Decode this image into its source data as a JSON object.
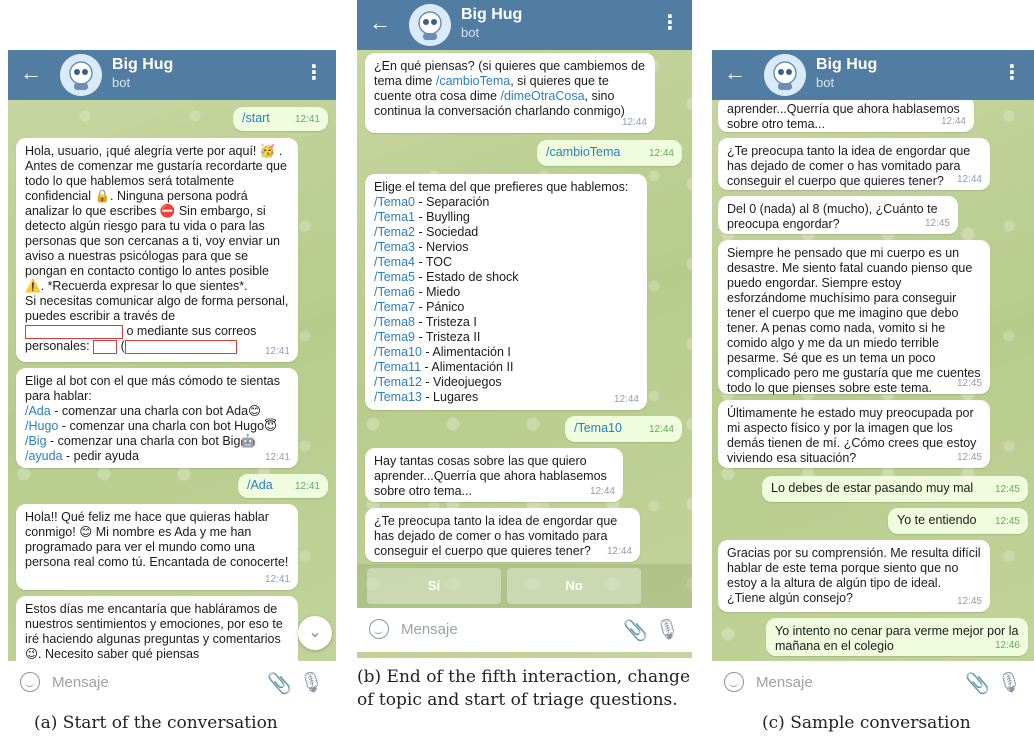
{
  "common": {
    "bot_name": "Big Hug",
    "bot_subtitle": "bot",
    "message_placeholder": "Mensaje"
  },
  "panel_a": {
    "caption": "(a) Start of the conversation",
    "messages": [
      {
        "dir": "out",
        "text": "/start",
        "time": "12:41"
      },
      {
        "dir": "in",
        "time": "12:41",
        "text": "Hola, usuario, ¡qué alegría verte por aquí! 🥳 . Antes de comenzar me gustaría recordarte que todo lo que hablemos será totalmente confidencial 🔒. Ninguna persona podrá analizar lo que escribes ⛔ Sin embargo, si detecto algún riesgo para tu vida o para las personas que son cercanas a ti, voy enviar un aviso a nuestras psicólogas para que se pongan en contacto contigo lo antes posible ⚠️. *Recuerda expresar lo que sientes*.",
        "text2": "Si necesitas comunicar algo de forma personal, puedes escribir a través de",
        "text3": "o mediante sus correos",
        "text4": "personales:"
      },
      {
        "dir": "in",
        "time": "12:41",
        "intro": "Elige al bot con el que más cómodo te sientas para hablar:",
        "lines": [
          {
            "cmd": "/Ada",
            "text": " - comenzar una charla con bot Ada😊"
          },
          {
            "cmd": "/Hugo",
            "text": " - comenzar una charla con bot Hugo😇"
          },
          {
            "cmd": "/Big",
            "text": " - comenzar una charla con bot Big🤖"
          },
          {
            "cmd": "/ayuda",
            "text": " - pedir ayuda"
          }
        ]
      },
      {
        "dir": "out",
        "text": "/Ada",
        "time": "12:41"
      },
      {
        "dir": "in",
        "time": "12:41",
        "text": "Hola!! Qué feliz me hace que quieras hablar conmigo! 😊 Mi nombre es Ada y me han programado para ver el mundo como una persona real como tú. Encantada de conocerte!"
      },
      {
        "dir": "in",
        "time": "",
        "text": "Estos días me encantaría que habláramos de nuestros sentimientos y emociones, por eso te iré haciendo algunas preguntas y comentarios 😉. Necesito saber qué piensas"
      }
    ]
  },
  "panel_b": {
    "caption": "(b) End of the fifth interaction, change of topic and start of triage questions.",
    "messages": [
      {
        "dir": "in",
        "time": "12:44",
        "pre": "¿En qué piensas? (si quieres que cambiemos de tema dime ",
        "cmd1": "/cambioTema",
        "mid": ", si quieres que te cuente otra cosa dime ",
        "cmd2": "/dimeOtraCosa",
        "post": ", sino continua la conversación charlando conmigo)"
      },
      {
        "dir": "out",
        "text": "/cambioTema",
        "time": "12:44"
      },
      {
        "dir": "in",
        "time": "12:44",
        "intro": "Elige el tema del que prefieres que hablemos:",
        "topics": [
          {
            "cmd": "/Tema0",
            "text": " - Separación"
          },
          {
            "cmd": "/Tema1",
            "text": " - Buylling"
          },
          {
            "cmd": "/Tema2",
            "text": " - Sociedad"
          },
          {
            "cmd": "/Tema3",
            "text": " - Nervios"
          },
          {
            "cmd": "/Tema4",
            "text": " - TOC"
          },
          {
            "cmd": "/Tema5",
            "text": " - Estado de shock"
          },
          {
            "cmd": "/Tema6",
            "text": " - Miedo"
          },
          {
            "cmd": "/Tema7",
            "text": " - Pánico"
          },
          {
            "cmd": "/Tema8",
            "text": " - Tristeza I"
          },
          {
            "cmd": "/Tema9",
            "text": " - Tristeza II"
          },
          {
            "cmd": "/Tema10",
            "text": " - Alimentación I"
          },
          {
            "cmd": "/Tema11",
            "text": " - Alimentación II"
          },
          {
            "cmd": "/Tema12",
            "text": " - Videojuegos"
          },
          {
            "cmd": "/Tema13",
            "text": " - Lugares"
          }
        ]
      },
      {
        "dir": "out",
        "text": "/Tema10",
        "time": "12:44"
      },
      {
        "dir": "in",
        "time": "12:44",
        "text": "Hay tantas cosas sobre las que quiero aprender...Querría que ahora hablasemos sobre otro tema..."
      },
      {
        "dir": "in",
        "time": "12:44",
        "text": "¿Te preocupa tanto la idea de engordar que has dejado de comer o has vomitado para conseguir el cuerpo que quieres tener?"
      }
    ],
    "keyboard": [
      "Sí",
      "No"
    ]
  },
  "panel_c": {
    "caption": "(c) Sample conversation",
    "messages": [
      {
        "dir": "in",
        "time": "12:44",
        "text": "aprender...Querría que ahora hablasemos sobre otro tema..."
      },
      {
        "dir": "in",
        "time": "12:44",
        "text": "¿Te preocupa tanto la idea de engordar que has dejado de comer o has vomitado para conseguir el cuerpo que quieres tener?"
      },
      {
        "dir": "in",
        "time": "12:45",
        "text": "Del 0 (nada) al 8 (mucho), ¿Cuánto te preocupa engordar?"
      },
      {
        "dir": "in",
        "time": "12:45",
        "text": "Siempre he pensado que mi cuerpo es un desastre. Me siento fatal cuando pienso que puedo engordar. Siempre estoy esforzándome muchísimo para conseguir tener el cuerpo que me imagino que debo tener. A penas como nada, vomito si he comido algo y me da un miedo terrible pesarme. Sé que es un tema un poco complicado pero me gustaría que me cuentes todo lo que pienses sobre este tema."
      },
      {
        "dir": "in",
        "time": "12:45",
        "text": "Últimamente he estado muy preocupada por mi aspecto físico y por la imagen que los demás tienen de mí. ¿Cómo crees que estoy viviendo esa situación?"
      },
      {
        "dir": "out",
        "time": "12:45",
        "text": "Lo debes de estar pasando muy mal"
      },
      {
        "dir": "out",
        "time": "12:45",
        "text": "Yo te entiendo"
      },
      {
        "dir": "in",
        "time": "12:45",
        "text": "Gracias por su comprensión. Me resulta difícil hablar de este tema porque siento que no estoy a la altura de algún tipo de ideal. ¿Tiene algún consejo?"
      },
      {
        "dir": "out",
        "time": "12:46",
        "text": "Yo intento no cenar para verme mejor por la mañana en el colegio"
      }
    ]
  }
}
